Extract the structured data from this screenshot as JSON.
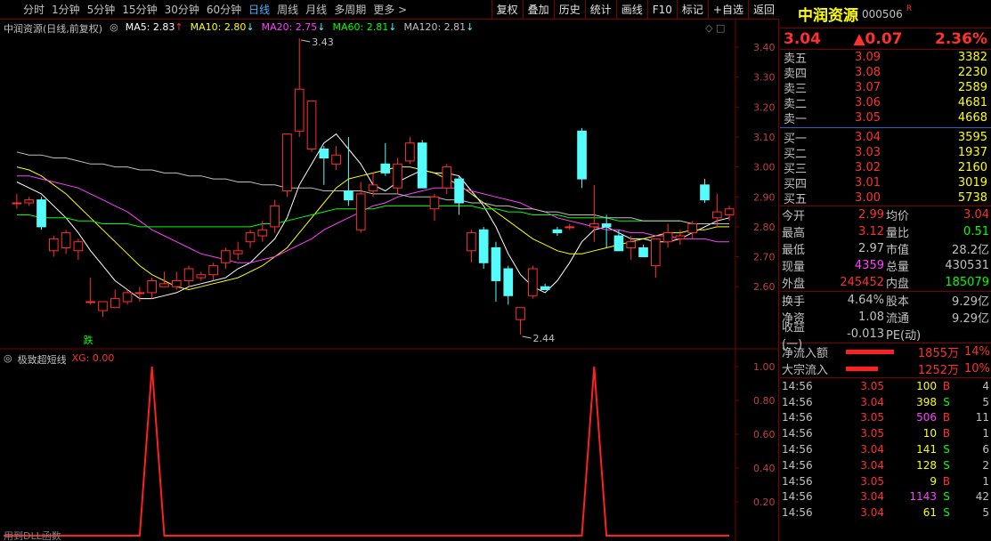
{
  "toolbar": {
    "periods": [
      {
        "label": "分时",
        "active": false
      },
      {
        "label": "1分钟",
        "active": false
      },
      {
        "label": "5分钟",
        "active": false
      },
      {
        "label": "15分钟",
        "active": false
      },
      {
        "label": "30分钟",
        "active": false
      },
      {
        "label": "60分钟",
        "active": false
      },
      {
        "label": "日线",
        "active": true
      },
      {
        "label": "周线",
        "active": false
      },
      {
        "label": "月线",
        "active": false
      },
      {
        "label": "多周期",
        "active": false
      },
      {
        "label": "更多 >",
        "active": false
      }
    ],
    "actions": [
      "复权",
      "叠加",
      "历史",
      "统计",
      "画线",
      "F10",
      "标记",
      "+自选",
      "返回"
    ]
  },
  "chart_header": {
    "name": "中润资源(日线,前复权)",
    "ma": [
      {
        "label": "MA5: 2.83",
        "arrow": "↑",
        "color": "#ffffff"
      },
      {
        "label": "MA10: 2.80",
        "arrow": "↓",
        "color": "#ffff00"
      },
      {
        "label": "MA20: 2.75",
        "arrow": "↓",
        "color": "#ff40ff"
      },
      {
        "label": "MA60: 2.81",
        "arrow": "↓",
        "color": "#00ff00"
      },
      {
        "label": "MA120: 2.81",
        "arrow": "↓",
        "color": "#c0c0c0"
      }
    ]
  },
  "sub_header": {
    "name": "极致超短线",
    "indicator": "XG: 0.00"
  },
  "bottom_text": "用到DLL函数",
  "annotations": {
    "high": "3.43",
    "low": "2.44",
    "signal": "跌"
  },
  "colors": {
    "up": "#ff3030",
    "down": "#54fcfc",
    "frame": "#7a0000"
  },
  "chart_data": [
    {
      "type": "candlestick",
      "y_ticks": [
        "3.40",
        "3.30",
        "3.20",
        "3.10",
        "3.00",
        "2.90",
        "2.80",
        "2.70",
        "2.60"
      ],
      "ylim": [
        2.44,
        3.43
      ],
      "candles": [
        {
          "o": 2.88,
          "h": 2.91,
          "l": 2.86,
          "c": 2.88
        },
        {
          "o": 2.88,
          "h": 2.9,
          "l": 2.87,
          "c": 2.89
        },
        {
          "o": 2.89,
          "h": 2.9,
          "l": 2.79,
          "c": 2.8
        },
        {
          "o": 2.72,
          "h": 2.77,
          "l": 2.7,
          "c": 2.76
        },
        {
          "o": 2.73,
          "h": 2.79,
          "l": 2.71,
          "c": 2.78
        },
        {
          "o": 2.72,
          "h": 2.76,
          "l": 2.69,
          "c": 2.75
        },
        {
          "o": 2.55,
          "h": 2.63,
          "l": 2.54,
          "c": 2.55
        },
        {
          "o": 2.52,
          "h": 2.55,
          "l": 2.5,
          "c": 2.55
        },
        {
          "o": 2.53,
          "h": 2.59,
          "l": 2.53,
          "c": 2.56
        },
        {
          "o": 2.55,
          "h": 2.59,
          "l": 2.54,
          "c": 2.58
        },
        {
          "o": 2.58,
          "h": 2.6,
          "l": 2.55,
          "c": 2.58
        },
        {
          "o": 2.58,
          "h": 2.63,
          "l": 2.56,
          "c": 2.62
        },
        {
          "o": 2.6,
          "h": 2.65,
          "l": 2.6,
          "c": 2.61
        },
        {
          "o": 2.6,
          "h": 2.65,
          "l": 2.59,
          "c": 2.62
        },
        {
          "o": 2.62,
          "h": 2.67,
          "l": 2.6,
          "c": 2.66
        },
        {
          "o": 2.63,
          "h": 2.65,
          "l": 2.62,
          "c": 2.64
        },
        {
          "o": 2.64,
          "h": 2.68,
          "l": 2.62,
          "c": 2.67
        },
        {
          "o": 2.68,
          "h": 2.73,
          "l": 2.66,
          "c": 2.72
        },
        {
          "o": 2.71,
          "h": 2.75,
          "l": 2.69,
          "c": 2.72
        },
        {
          "o": 2.75,
          "h": 2.79,
          "l": 2.73,
          "c": 2.78
        },
        {
          "o": 2.77,
          "h": 2.82,
          "l": 2.75,
          "c": 2.79
        },
        {
          "o": 2.8,
          "h": 2.89,
          "l": 2.78,
          "c": 2.87
        },
        {
          "o": 2.92,
          "h": 3.11,
          "l": 2.9,
          "c": 3.11
        },
        {
          "o": 3.12,
          "h": 3.43,
          "l": 3.1,
          "c": 3.26
        },
        {
          "o": 3.06,
          "h": 3.18,
          "l": 3.05,
          "c": 3.22
        },
        {
          "o": 3.06,
          "h": 3.07,
          "l": 2.94,
          "c": 3.03
        },
        {
          "o": 3.01,
          "h": 3.07,
          "l": 2.99,
          "c": 3.04
        },
        {
          "o": 2.92,
          "h": 3.1,
          "l": 2.87,
          "c": 2.89
        },
        {
          "o": 2.79,
          "h": 2.95,
          "l": 2.78,
          "c": 2.91
        },
        {
          "o": 2.92,
          "h": 2.98,
          "l": 2.9,
          "c": 2.94
        },
        {
          "o": 3.01,
          "h": 3.08,
          "l": 2.97,
          "c": 2.98
        },
        {
          "o": 2.93,
          "h": 3.03,
          "l": 2.91,
          "c": 3.01
        },
        {
          "o": 3.02,
          "h": 3.1,
          "l": 3.01,
          "c": 3.08
        },
        {
          "o": 3.08,
          "h": 3.09,
          "l": 2.93,
          "c": 2.93
        },
        {
          "o": 2.86,
          "h": 2.91,
          "l": 2.82,
          "c": 2.9
        },
        {
          "o": 2.93,
          "h": 3.01,
          "l": 2.91,
          "c": 3.0
        },
        {
          "o": 2.96,
          "h": 2.97,
          "l": 2.84,
          "c": 2.88
        },
        {
          "o": 2.72,
          "h": 2.79,
          "l": 2.68,
          "c": 2.78
        },
        {
          "o": 2.79,
          "h": 2.8,
          "l": 2.66,
          "c": 2.68
        },
        {
          "o": 2.73,
          "h": 2.75,
          "l": 2.55,
          "c": 2.62
        },
        {
          "o": 2.66,
          "h": 2.67,
          "l": 2.54,
          "c": 2.57
        },
        {
          "o": 2.49,
          "h": 2.53,
          "l": 2.44,
          "c": 2.53
        },
        {
          "o": 2.57,
          "h": 2.67,
          "l": 2.56,
          "c": 2.66
        },
        {
          "o": 2.6,
          "h": 2.61,
          "l": 2.59,
          "c": 2.59
        },
        {
          "o": 2.79,
          "h": 2.8,
          "l": 2.77,
          "c": 2.78
        },
        {
          "o": 2.8,
          "h": 2.81,
          "l": 2.79,
          "c": 2.8
        },
        {
          "o": 3.12,
          "h": 3.13,
          "l": 2.93,
          "c": 2.96
        },
        {
          "o": 2.8,
          "h": 2.94,
          "l": 2.75,
          "c": 2.81
        },
        {
          "o": 2.81,
          "h": 2.84,
          "l": 2.73,
          "c": 2.8
        },
        {
          "o": 2.77,
          "h": 2.79,
          "l": 2.72,
          "c": 2.72
        },
        {
          "o": 2.73,
          "h": 2.77,
          "l": 2.69,
          "c": 2.75
        },
        {
          "o": 2.73,
          "h": 2.74,
          "l": 2.7,
          "c": 2.7
        },
        {
          "o": 2.67,
          "h": 2.76,
          "l": 2.63,
          "c": 2.76
        },
        {
          "o": 2.75,
          "h": 2.81,
          "l": 2.73,
          "c": 2.78
        },
        {
          "o": 2.76,
          "h": 2.79,
          "l": 2.74,
          "c": 2.77
        },
        {
          "o": 2.78,
          "h": 2.82,
          "l": 2.76,
          "c": 2.81
        },
        {
          "o": 2.94,
          "h": 2.96,
          "l": 2.88,
          "c": 2.89
        },
        {
          "o": 2.83,
          "h": 2.91,
          "l": 2.8,
          "c": 2.85
        },
        {
          "o": 2.84,
          "h": 2.87,
          "l": 2.82,
          "c": 2.86
        }
      ],
      "ma_series": [
        {
          "color": "#ffffff",
          "values": [
            2.95,
            2.93,
            2.91,
            2.87,
            2.83,
            2.78,
            2.72,
            2.67,
            2.62,
            2.59,
            2.56,
            2.56,
            2.57,
            2.58,
            2.6,
            2.61,
            2.62,
            2.63,
            2.66,
            2.68,
            2.72,
            2.76,
            2.83,
            2.94,
            3.01,
            3.08,
            3.11,
            3.06,
            3.01,
            2.94,
            2.92,
            2.95,
            2.97,
            2.99,
            2.98,
            2.98,
            2.97,
            2.92,
            2.87,
            2.8,
            2.71,
            2.64,
            2.6,
            2.58,
            2.62,
            2.68,
            2.75,
            2.79,
            2.8,
            2.78,
            2.76,
            2.76,
            2.75,
            2.75,
            2.76,
            2.78,
            2.8,
            2.82,
            2.83
          ]
        },
        {
          "color": "#ffff00",
          "values": [
            3.0,
            2.99,
            2.97,
            2.94,
            2.91,
            2.87,
            2.83,
            2.79,
            2.75,
            2.71,
            2.67,
            2.64,
            2.62,
            2.6,
            2.59,
            2.6,
            2.61,
            2.62,
            2.63,
            2.65,
            2.67,
            2.7,
            2.73,
            2.78,
            2.83,
            2.88,
            2.93,
            2.96,
            2.97,
            2.98,
            2.99,
            3.0,
            3.0,
            2.99,
            2.98,
            2.96,
            2.94,
            2.91,
            2.88,
            2.85,
            2.82,
            2.79,
            2.76,
            2.74,
            2.72,
            2.71,
            2.71,
            2.72,
            2.73,
            2.74,
            2.75,
            2.76,
            2.77,
            2.78,
            2.78,
            2.79,
            2.79,
            2.8,
            2.8
          ]
        },
        {
          "color": "#ff40ff",
          "values": [
            2.97,
            2.97,
            2.96,
            2.95,
            2.94,
            2.93,
            2.91,
            2.89,
            2.87,
            2.85,
            2.82,
            2.79,
            2.77,
            2.75,
            2.73,
            2.71,
            2.7,
            2.69,
            2.68,
            2.68,
            2.69,
            2.7,
            2.72,
            2.74,
            2.76,
            2.79,
            2.81,
            2.83,
            2.85,
            2.87,
            2.88,
            2.9,
            2.91,
            2.92,
            2.93,
            2.93,
            2.93,
            2.92,
            2.91,
            2.9,
            2.89,
            2.88,
            2.86,
            2.85,
            2.83,
            2.82,
            2.81,
            2.8,
            2.79,
            2.79,
            2.78,
            2.78,
            2.77,
            2.77,
            2.76,
            2.76,
            2.76,
            2.75,
            2.75
          ]
        },
        {
          "color": "#00ff00",
          "values": [
            2.84,
            2.84,
            2.83,
            2.83,
            2.83,
            2.82,
            2.82,
            2.81,
            2.81,
            2.81,
            2.8,
            2.8,
            2.8,
            2.8,
            2.8,
            2.8,
            2.8,
            2.8,
            2.8,
            2.8,
            2.81,
            2.81,
            2.82,
            2.83,
            2.84,
            2.85,
            2.86,
            2.86,
            2.86,
            2.86,
            2.87,
            2.87,
            2.87,
            2.87,
            2.87,
            2.87,
            2.87,
            2.87,
            2.86,
            2.86,
            2.85,
            2.85,
            2.84,
            2.84,
            2.84,
            2.83,
            2.83,
            2.83,
            2.83,
            2.82,
            2.82,
            2.82,
            2.82,
            2.82,
            2.82,
            2.81,
            2.81,
            2.81,
            2.81
          ]
        },
        {
          "color": "#c0c0c0",
          "values": [
            3.05,
            3.04,
            3.04,
            3.03,
            3.03,
            3.02,
            3.01,
            3.01,
            3.0,
            3.0,
            2.99,
            2.99,
            2.98,
            2.98,
            2.97,
            2.97,
            2.96,
            2.96,
            2.95,
            2.95,
            2.94,
            2.94,
            2.93,
            2.93,
            2.93,
            2.92,
            2.92,
            2.92,
            2.92,
            2.91,
            2.91,
            2.91,
            2.9,
            2.9,
            2.9,
            2.89,
            2.89,
            2.88,
            2.88,
            2.87,
            2.87,
            2.86,
            2.86,
            2.85,
            2.85,
            2.84,
            2.84,
            2.84,
            2.83,
            2.83,
            2.83,
            2.82,
            2.82,
            2.82,
            2.82,
            2.81,
            2.81,
            2.81,
            2.81
          ]
        }
      ]
    },
    {
      "type": "line",
      "name": "XG",
      "y_ticks": [
        "1.00",
        "0.80",
        "0.60",
        "0.40",
        "0.20"
      ],
      "ylim": [
        0,
        1
      ],
      "values": [
        0,
        0,
        0,
        0,
        0,
        0,
        0,
        0,
        0,
        0,
        0,
        0,
        0,
        0,
        0,
        0,
        0,
        0,
        0,
        0,
        0,
        0,
        0,
        0,
        0,
        0,
        0,
        0,
        0,
        0,
        0,
        0,
        0,
        0,
        0,
        0,
        0,
        0,
        0,
        0,
        0,
        0,
        0,
        0,
        0,
        0,
        0,
        0,
        0,
        0,
        0,
        0,
        0,
        0,
        0,
        0,
        0,
        0,
        0
      ],
      "spikes": [
        {
          "at": 11,
          "value": 1.0
        },
        {
          "at": 47,
          "value": 1.0
        }
      ]
    }
  ],
  "panel": {
    "name": "中润资源",
    "code": "000506",
    "flag": "R",
    "price": "3.04",
    "change": "▲0.07",
    "pct": "2.36%",
    "asks": [
      {
        "label": "卖五",
        "price": "3.09",
        "vol": "3382"
      },
      {
        "label": "卖四",
        "price": "3.08",
        "vol": "2230"
      },
      {
        "label": "卖三",
        "price": "3.07",
        "vol": "2589"
      },
      {
        "label": "卖二",
        "price": "3.06",
        "vol": "4681"
      },
      {
        "label": "卖一",
        "price": "3.05",
        "vol": "4668"
      }
    ],
    "bids": [
      {
        "label": "买一",
        "price": "3.04",
        "vol": "3595"
      },
      {
        "label": "买二",
        "price": "3.03",
        "vol": "1937"
      },
      {
        "label": "买三",
        "price": "3.02",
        "vol": "2160"
      },
      {
        "label": "买四",
        "price": "3.01",
        "vol": "3019"
      },
      {
        "label": "买五",
        "price": "3.00",
        "vol": "5738"
      }
    ],
    "stats1": [
      {
        "l1": "今开",
        "v1": "2.99",
        "c1": "#ff3030",
        "l2": "均价",
        "v2": "3.04",
        "c2": "#ff3030"
      },
      {
        "l1": "最高",
        "v1": "3.12",
        "c1": "#ff3030",
        "l2": "量比",
        "v2": "0.51",
        "c2": "#00ff00"
      },
      {
        "l1": "最低",
        "v1": "2.97",
        "c1": "#c0c0c0",
        "l2": "市值",
        "v2": "28.2亿",
        "c2": "#c0c0c0"
      },
      {
        "l1": "现量",
        "v1": "4359",
        "c1": "#ff40ff",
        "l2": "总量",
        "v2": "430531",
        "c2": "#c0c0c0"
      },
      {
        "l1": "外盘",
        "v1": "245452",
        "c1": "#ff3030",
        "l2": "内盘",
        "v2": "185079",
        "c2": "#00ff00"
      }
    ],
    "stats2": [
      {
        "l1": "换手",
        "v1": "4.64%",
        "l2": "股本",
        "v2": "9.29亿"
      },
      {
        "l1": "净资",
        "v1": "1.08",
        "l2": "流通",
        "v2": "9.29亿"
      },
      {
        "l1": "收益(一)",
        "v1": "-0.013",
        "l2": "PE(动)",
        "v2": ""
      }
    ],
    "flows": [
      {
        "label": "净流入额",
        "value": "1855万",
        "pct": "14%",
        "bar": 0.9
      },
      {
        "label": "大宗流入",
        "value": "1252万",
        "pct": "10%",
        "bar": 0.6
      }
    ],
    "ticks": [
      {
        "time": "14:56",
        "price": "3.05",
        "vol": "100",
        "side": "B",
        "cnt": "4"
      },
      {
        "time": "14:56",
        "price": "3.04",
        "vol": "398",
        "side": "S",
        "cnt": "5"
      },
      {
        "time": "14:56",
        "price": "3.05",
        "vol": "506",
        "side": "B",
        "cnt": "11"
      },
      {
        "time": "14:56",
        "price": "3.05",
        "vol": "10",
        "side": "B",
        "cnt": "1"
      },
      {
        "time": "14:56",
        "price": "3.04",
        "vol": "141",
        "side": "S",
        "cnt": "6"
      },
      {
        "time": "14:56",
        "price": "3.04",
        "vol": "128",
        "side": "S",
        "cnt": "2"
      },
      {
        "time": "14:56",
        "price": "3.05",
        "vol": "9",
        "side": "B",
        "cnt": "1"
      },
      {
        "time": "14:56",
        "price": "3.04",
        "vol": "1143",
        "side": "S",
        "cnt": "42"
      },
      {
        "time": "14:56",
        "price": "3.04",
        "vol": "61",
        "side": "S",
        "cnt": "5"
      }
    ]
  }
}
